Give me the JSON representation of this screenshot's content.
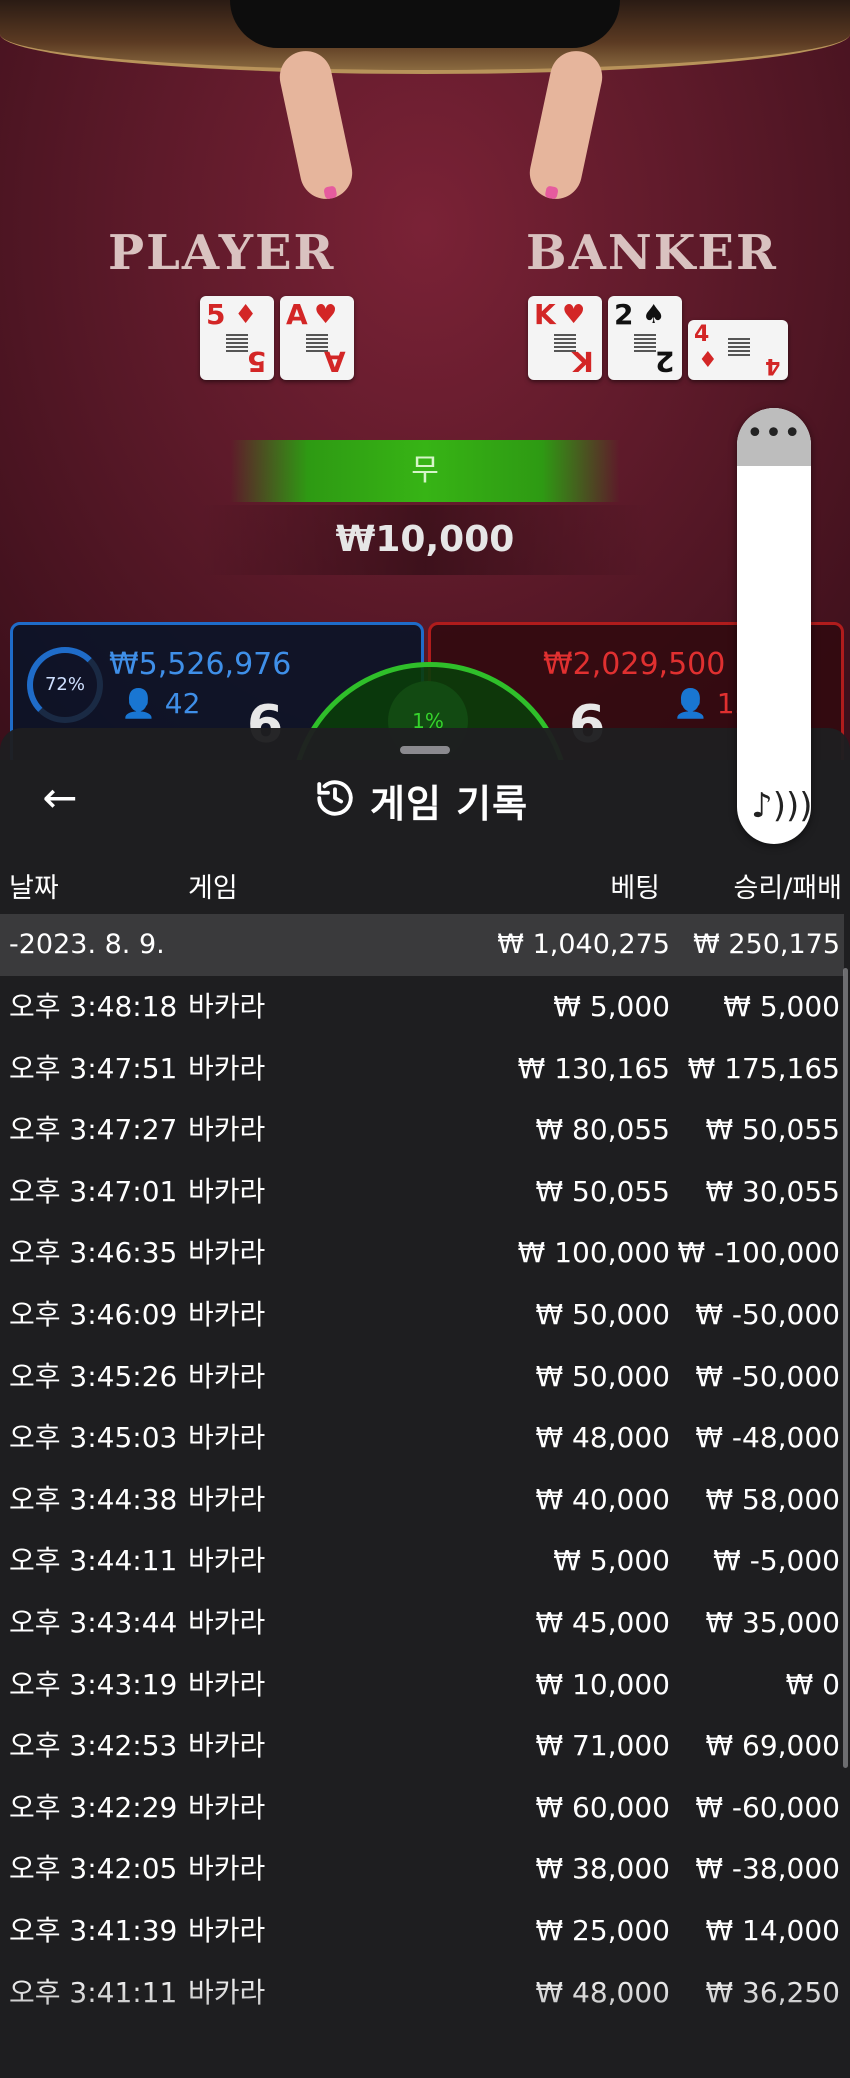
{
  "scene": {
    "player_label": "PLAYER",
    "banker_label": "BANKER",
    "player_cards": [
      {
        "rank": "5",
        "suit": "♦",
        "color": "red"
      },
      {
        "rank": "A",
        "suit": "♥",
        "color": "red"
      }
    ],
    "banker_cards": [
      {
        "rank": "K",
        "suit": "♥",
        "color": "red"
      },
      {
        "rank": "2",
        "suit": "♠",
        "color": "black"
      },
      {
        "rank": "4",
        "suit": "♦",
        "color": "red"
      }
    ],
    "result_text": "무",
    "result_amount": "₩10,000",
    "player_panel": {
      "percent": "72%",
      "amount": "₩5,526,976",
      "players": "42",
      "score": "6"
    },
    "banker_panel": {
      "amount": "₩2,029,500",
      "players": "13",
      "score": "6"
    },
    "tie_percent": "1%"
  },
  "history": {
    "title": "게임 기록",
    "columns": {
      "date": "날짜",
      "game": "게임",
      "bet": "베팅",
      "result": "승리/패배"
    },
    "group": {
      "date": "-2023. 8. 9.",
      "bet": "₩ 1,040,275",
      "result": "₩ 250,175"
    },
    "rows": [
      {
        "time": "오후 3:48:18",
        "game": "바카라",
        "bet": "₩ 5,000",
        "result": "₩ 5,000"
      },
      {
        "time": "오후 3:47:51",
        "game": "바카라",
        "bet": "₩ 130,165",
        "result": "₩ 175,165"
      },
      {
        "time": "오후 3:47:27",
        "game": "바카라",
        "bet": "₩ 80,055",
        "result": "₩ 50,055"
      },
      {
        "time": "오후 3:47:01",
        "game": "바카라",
        "bet": "₩ 50,055",
        "result": "₩ 30,055"
      },
      {
        "time": "오후 3:46:35",
        "game": "바카라",
        "bet": "₩ 100,000",
        "result": "₩ -100,000"
      },
      {
        "time": "오후 3:46:09",
        "game": "바카라",
        "bet": "₩ 50,000",
        "result": "₩ -50,000"
      },
      {
        "time": "오후 3:45:26",
        "game": "바카라",
        "bet": "₩ 50,000",
        "result": "₩ -50,000"
      },
      {
        "time": "오후 3:45:03",
        "game": "바카라",
        "bet": "₩ 48,000",
        "result": "₩ -48,000"
      },
      {
        "time": "오후 3:44:38",
        "game": "바카라",
        "bet": "₩ 40,000",
        "result": "₩ 58,000"
      },
      {
        "time": "오후 3:44:11",
        "game": "바카라",
        "bet": "₩ 5,000",
        "result": "₩ -5,000"
      },
      {
        "time": "오후 3:43:44",
        "game": "바카라",
        "bet": "₩ 45,000",
        "result": "₩ 35,000"
      },
      {
        "time": "오후 3:43:19",
        "game": "바카라",
        "bet": "₩ 10,000",
        "result": "₩ 0"
      },
      {
        "time": "오후 3:42:53",
        "game": "바카라",
        "bet": "₩ 71,000",
        "result": "₩ 69,000"
      },
      {
        "time": "오후 3:42:29",
        "game": "바카라",
        "bet": "₩ 60,000",
        "result": "₩ -60,000"
      },
      {
        "time": "오후 3:42:05",
        "game": "바카라",
        "bet": "₩ 38,000",
        "result": "₩ -38,000"
      },
      {
        "time": "오후 3:41:39",
        "game": "바카라",
        "bet": "₩ 25,000",
        "result": "₩ 14,000"
      },
      {
        "time": "오후 3:41:11",
        "game": "바카라",
        "bet": "₩ 48,000",
        "result": "₩ 36,250"
      }
    ]
  },
  "volume": {
    "menu_icon": "ellipsis-icon",
    "sound_icon": "sound-wave-icon"
  },
  "colors": {
    "player": "#1f6cc9",
    "banker": "#b01c1c",
    "tie": "#2fbf2a",
    "sheet_bg": "#1e1e20"
  }
}
